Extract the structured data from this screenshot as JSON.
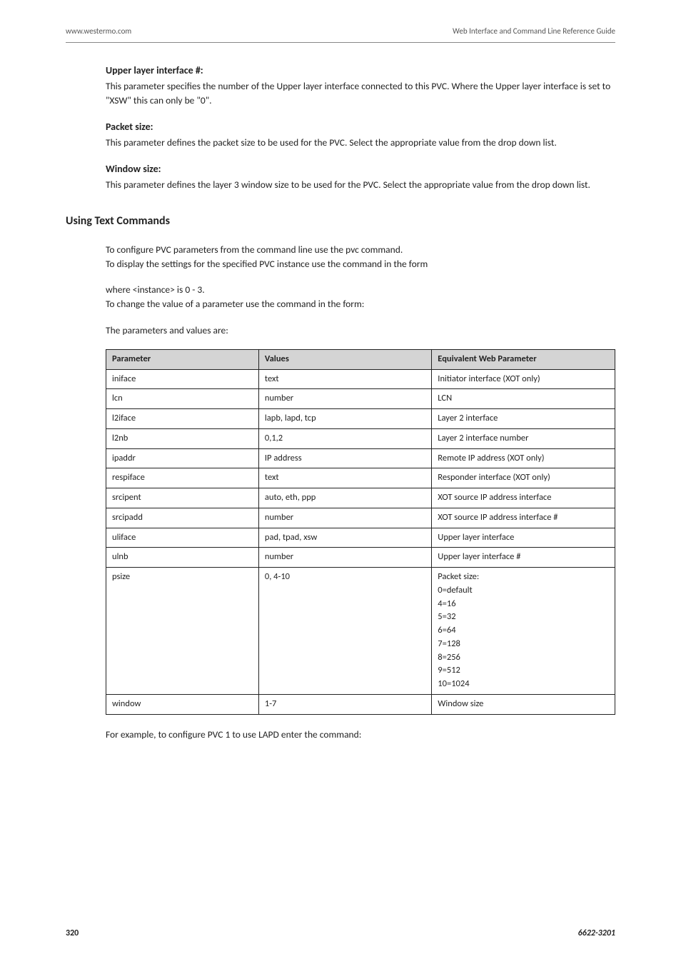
{
  "header": {
    "left": "www.westermo.com",
    "right": "Web Interface and Command Line Reference Guide"
  },
  "sections": [
    {
      "heading": "Upper layer interface #:",
      "text": "This parameter specifies the number of the Upper layer interface connected to this PVC. Where the Upper layer interface is set to \"XSW\" this can only be \"0\"."
    },
    {
      "heading": "Packet size:",
      "text": "This parameter defines the packet size to be used for the PVC. Select the appropriate value from the drop down list."
    },
    {
      "heading": "Window size:",
      "text": "This parameter defines the layer 3 window size to be used for the PVC. Select the appropriate value from the drop down list."
    }
  ],
  "usingText": {
    "heading": "Using Text Commands",
    "para1a": "To configure PVC parameters from the command line use the pvc command.",
    "para1b": "To display the settings for the specified PVC instance use the command in the form",
    "para2a": "where <instance> is 0 - 3.",
    "para2b": "To change the value of a parameter use the command in the form:",
    "para3": "The parameters and values are:"
  },
  "table": {
    "headers": [
      "Parameter",
      "Values",
      "Equivalent Web Parameter"
    ],
    "rows": [
      [
        "iniface",
        "text",
        "Initiator interface (XOT only)"
      ],
      [
        "lcn",
        "number",
        "LCN"
      ],
      [
        "l2iface",
        "lapb, lapd, tcp",
        "Layer 2 interface"
      ],
      [
        "l2nb",
        "0,1,2",
        "Layer 2 interface number"
      ],
      [
        "ipaddr",
        "IP address",
        "Remote IP address (XOT only)"
      ],
      [
        "respiface",
        "text",
        "Responder interface (XOT only)"
      ],
      [
        "srcipent",
        "auto, eth, ppp",
        "XOT source IP address interface"
      ],
      [
        "srcipadd",
        "number",
        "XOT source IP address interface #"
      ],
      [
        "uliface",
        "pad, tpad, xsw",
        "Upper layer interface"
      ],
      [
        "ulnb",
        "number",
        "Upper layer interface #"
      ],
      [
        "psize",
        "0, 4-10",
        "Packet size:\n0=default\n4=16\n5=32\n6=64\n7=128\n8=256\n9=512\n10=1024"
      ],
      [
        "window",
        "1-7",
        "Window size"
      ]
    ]
  },
  "afterTable": "For example, to configure PVC 1 to use LAPD enter the command:",
  "footer": {
    "page": "320",
    "docnum": "6622-3201"
  }
}
